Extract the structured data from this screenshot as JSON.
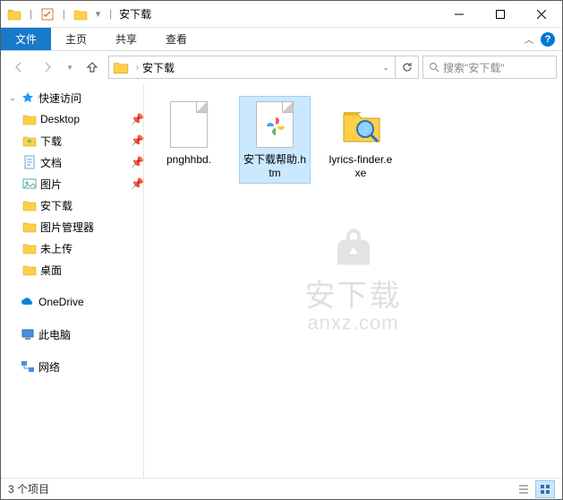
{
  "title": "安下载",
  "ribbon": {
    "file": "文件",
    "home": "主页",
    "share": "共享",
    "view": "查看"
  },
  "address": {
    "current": "安下载"
  },
  "search": {
    "placeholder": "搜索\"安下载\""
  },
  "sidebar": {
    "quick_access": "快速访问",
    "items": [
      {
        "label": "Desktop"
      },
      {
        "label": "下载"
      },
      {
        "label": "文档"
      },
      {
        "label": "图片"
      },
      {
        "label": "安下载"
      },
      {
        "label": "图片管理器"
      },
      {
        "label": "未上传"
      },
      {
        "label": "桌面"
      }
    ],
    "onedrive": "OneDrive",
    "this_pc": "此电脑",
    "network": "网络"
  },
  "files": [
    {
      "label": "pnghhbd."
    },
    {
      "label": "安下载帮助.htm"
    },
    {
      "label": "lyrics-finder.exe"
    }
  ],
  "watermark": {
    "main": "安下载",
    "sub": "anxz.com"
  },
  "status": {
    "count": "3 个项目"
  }
}
